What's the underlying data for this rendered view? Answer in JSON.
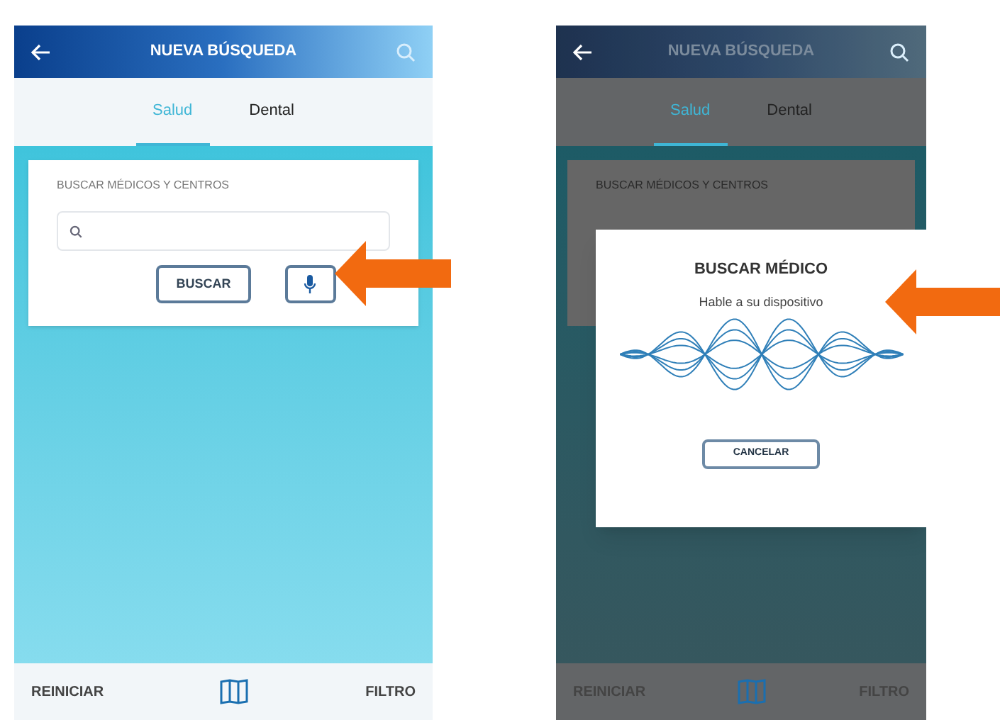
{
  "phones": [
    {
      "title": "NUEVA BÚSQUEDA",
      "dimmed": false,
      "tabs": [
        {
          "label": "Salud",
          "selected": true
        },
        {
          "label": "Dental",
          "selected": false
        }
      ],
      "search_label": "BUSCAR MÉDICOS Y CENTROS",
      "search_button": "BUSCAR",
      "bottom_bar": {
        "left": "REINICIAR",
        "right": "FILTRO"
      }
    },
    {
      "title": "NUEVA BÚSQUEDA",
      "dimmed": true,
      "tabs": [
        {
          "label": "Salud",
          "selected": true
        },
        {
          "label": "Dental",
          "selected": false
        }
      ],
      "search_label": "BUSCAR MÉDICOS Y CENTROS",
      "bottom_bar": {
        "left": "REINICIAR",
        "right": "FILTRO"
      },
      "modal": {
        "title": "BUSCAR MÉDICO",
        "message": "Hable a su dispositivo",
        "button": "CANCELAR"
      }
    }
  ]
}
